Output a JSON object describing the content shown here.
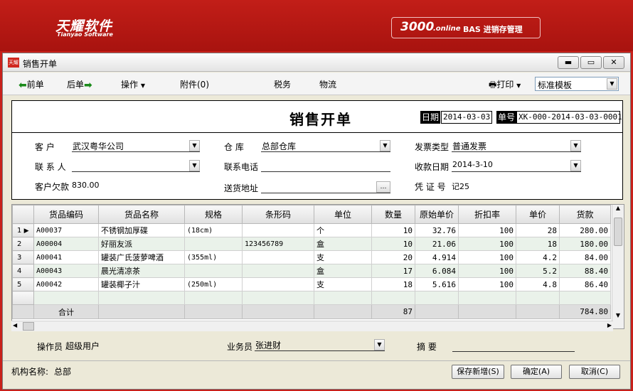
{
  "banner": {
    "brand_cn": "天耀软件",
    "brand_en": "Tianyao Software",
    "product_big": "3000",
    "product_small": ".online",
    "product_rest": "BAS  进销存管理"
  },
  "window": {
    "title": "销售开单",
    "icon_text": "天耀"
  },
  "toolbar": {
    "prev": "前单",
    "next": "后单",
    "operate": "操作",
    "attachment": "附件(0)",
    "tax": "税务",
    "logistics": "物流",
    "print": "打印",
    "template": "标准模板"
  },
  "form": {
    "title": "销售开单",
    "date_label": "日期",
    "date_value": "2014-03-03",
    "number_label": "单号",
    "number_value": "XK-000-2014-03-03-0001",
    "customer_label": "客    户",
    "customer_value": "武汉粤华公司",
    "warehouse_label": "仓    库",
    "warehouse_value": "总部仓库",
    "invoice_type_label": "发票类型",
    "invoice_type_value": "普通发票",
    "contact_label": "联 系 人",
    "contact_value": "",
    "phone_label": "联系电话",
    "phone_value": "",
    "pay_date_label": "收款日期",
    "pay_date_value": "2014-3-10",
    "debt_label": "客户欠款",
    "debt_value": "830.00",
    "address_label": "送货地址",
    "address_value": "",
    "voucher_label": "凭 证 号",
    "voucher_value": "记25"
  },
  "grid": {
    "columns": [
      "货品编码",
      "货品名称",
      "规格",
      "条形码",
      "单位",
      "数量",
      "原始单价",
      "折扣率",
      "单价",
      "货款"
    ],
    "rows": [
      {
        "idx": "1",
        "code": "A00037",
        "name": "不锈钢加厚碟",
        "spec": "(18cm)",
        "barcode": "",
        "unit": "个",
        "qty": "10",
        "orig_price": "32.76",
        "discount": "100",
        "price": "28",
        "amount": "280.00"
      },
      {
        "idx": "2",
        "code": "A00004",
        "name": "好丽友派",
        "spec": "",
        "barcode": "123456789",
        "unit": "盒",
        "qty": "10",
        "orig_price": "21.06",
        "discount": "100",
        "price": "18",
        "amount": "180.00"
      },
      {
        "idx": "3",
        "code": "A00041",
        "name": "罐装广氏菠萝啤酒",
        "spec": "(355ml)",
        "barcode": "",
        "unit": "支",
        "qty": "20",
        "orig_price": "4.914",
        "discount": "100",
        "price": "4.2",
        "amount": "84.00"
      },
      {
        "idx": "4",
        "code": "A00043",
        "name": "晨光清凉茶",
        "spec": "",
        "barcode": "",
        "unit": "盒",
        "qty": "17",
        "orig_price": "6.084",
        "discount": "100",
        "price": "5.2",
        "amount": "88.40"
      },
      {
        "idx": "5",
        "code": "A00042",
        "name": "罐装椰子汁",
        "spec": "(250ml)",
        "barcode": "",
        "unit": "支",
        "qty": "18",
        "orig_price": "5.616",
        "discount": "100",
        "price": "4.8",
        "amount": "86.40"
      }
    ],
    "total_label": "合计",
    "total_qty": "87",
    "total_amount": "784.80"
  },
  "footer": {
    "operator_label": "操作员",
    "operator_value": "超级用户",
    "salesman_label": "业务员",
    "salesman_value": "张进财",
    "summary_label": "摘    要",
    "summary_value": "",
    "org_label": "机构名称:",
    "org_value": "总部",
    "save_new": "保存新增(S)",
    "confirm": "确定(A)",
    "cancel": "取消(C)"
  }
}
